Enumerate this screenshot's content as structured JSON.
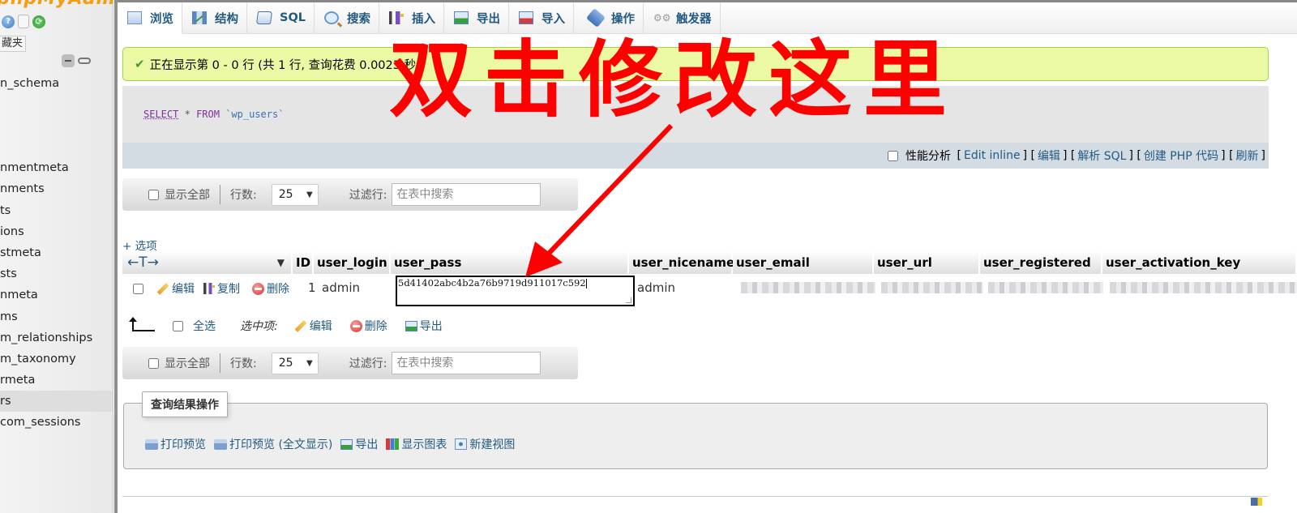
{
  "sidebar": {
    "logo": "phpMyAdmin",
    "favorites_label": "藏夹",
    "items": [
      {
        "label": "n_schema"
      },
      {
        "label": ""
      },
      {
        "label": "nmentmeta"
      },
      {
        "label": "nments"
      },
      {
        "label": "ts"
      },
      {
        "label": "ions"
      },
      {
        "label": "stmeta"
      },
      {
        "label": "sts"
      },
      {
        "label": "nmeta"
      },
      {
        "label": "ms"
      },
      {
        "label": "m_relationships"
      },
      {
        "label": "m_taxonomy"
      },
      {
        "label": "rmeta"
      },
      {
        "label": "rs",
        "active": true
      },
      {
        "label": "com_sessions"
      }
    ]
  },
  "tabs": [
    {
      "label": "浏览",
      "icon": "browse-icon",
      "active": true
    },
    {
      "label": "结构",
      "icon": "structure-icon"
    },
    {
      "label": "SQL",
      "icon": "sql-icon"
    },
    {
      "label": "搜索",
      "icon": "search-icon"
    },
    {
      "label": "插入",
      "icon": "insert-icon"
    },
    {
      "label": "导出",
      "icon": "export-icon"
    },
    {
      "label": "导入",
      "icon": "import-icon"
    },
    {
      "label": "操作",
      "icon": "wrench-icon"
    },
    {
      "label": "触发器",
      "icon": "trigger-icon"
    }
  ],
  "success_message": "正在显示第 0 - 0 行 (共 1 行, 查询花费 0.0023 秒。",
  "sql": {
    "select": "SELECT",
    "star": "*",
    "from": "FROM",
    "table": "`wp_users`"
  },
  "sql_actions": {
    "profiling": "性能分析",
    "links": [
      "Edit inline",
      "编辑",
      "解析 SQL",
      "创建 PHP 代码",
      "刷新"
    ]
  },
  "nav": {
    "show_all": "显示全部",
    "rows_label": "行数:",
    "rows_value": "25",
    "filter_label": "过滤行:",
    "filter_placeholder": "在表中搜索"
  },
  "options_label": "+ 选项",
  "table": {
    "columns": [
      "ID",
      "user_login",
      "user_pass",
      "user_nicename",
      "user_email",
      "user_url",
      "user_registered",
      "user_activation_key"
    ],
    "row_actions": {
      "edit": "编辑",
      "copy": "复制",
      "delete": "删除"
    },
    "rows": [
      {
        "ID": "1",
        "user_login": "admin",
        "user_pass": "5d41402abc4b2a76b9719d911017c592",
        "user_nicename": "admin"
      }
    ]
  },
  "bulk": {
    "select_all": "全选",
    "with_selected": "选中项:",
    "edit": "编辑",
    "delete": "删除",
    "export": "导出"
  },
  "query_ops": {
    "legend": "查询结果操作",
    "items": [
      "打印预览",
      "打印预览 (全文显示)",
      "导出",
      "显示图表",
      "新建视图"
    ]
  },
  "annotation": {
    "text": "双击修改这里",
    "color": "#ff0000"
  },
  "colors": {
    "link": "#235a81",
    "success_bg": "#ebf8a4",
    "success_border": "#a2d246"
  }
}
